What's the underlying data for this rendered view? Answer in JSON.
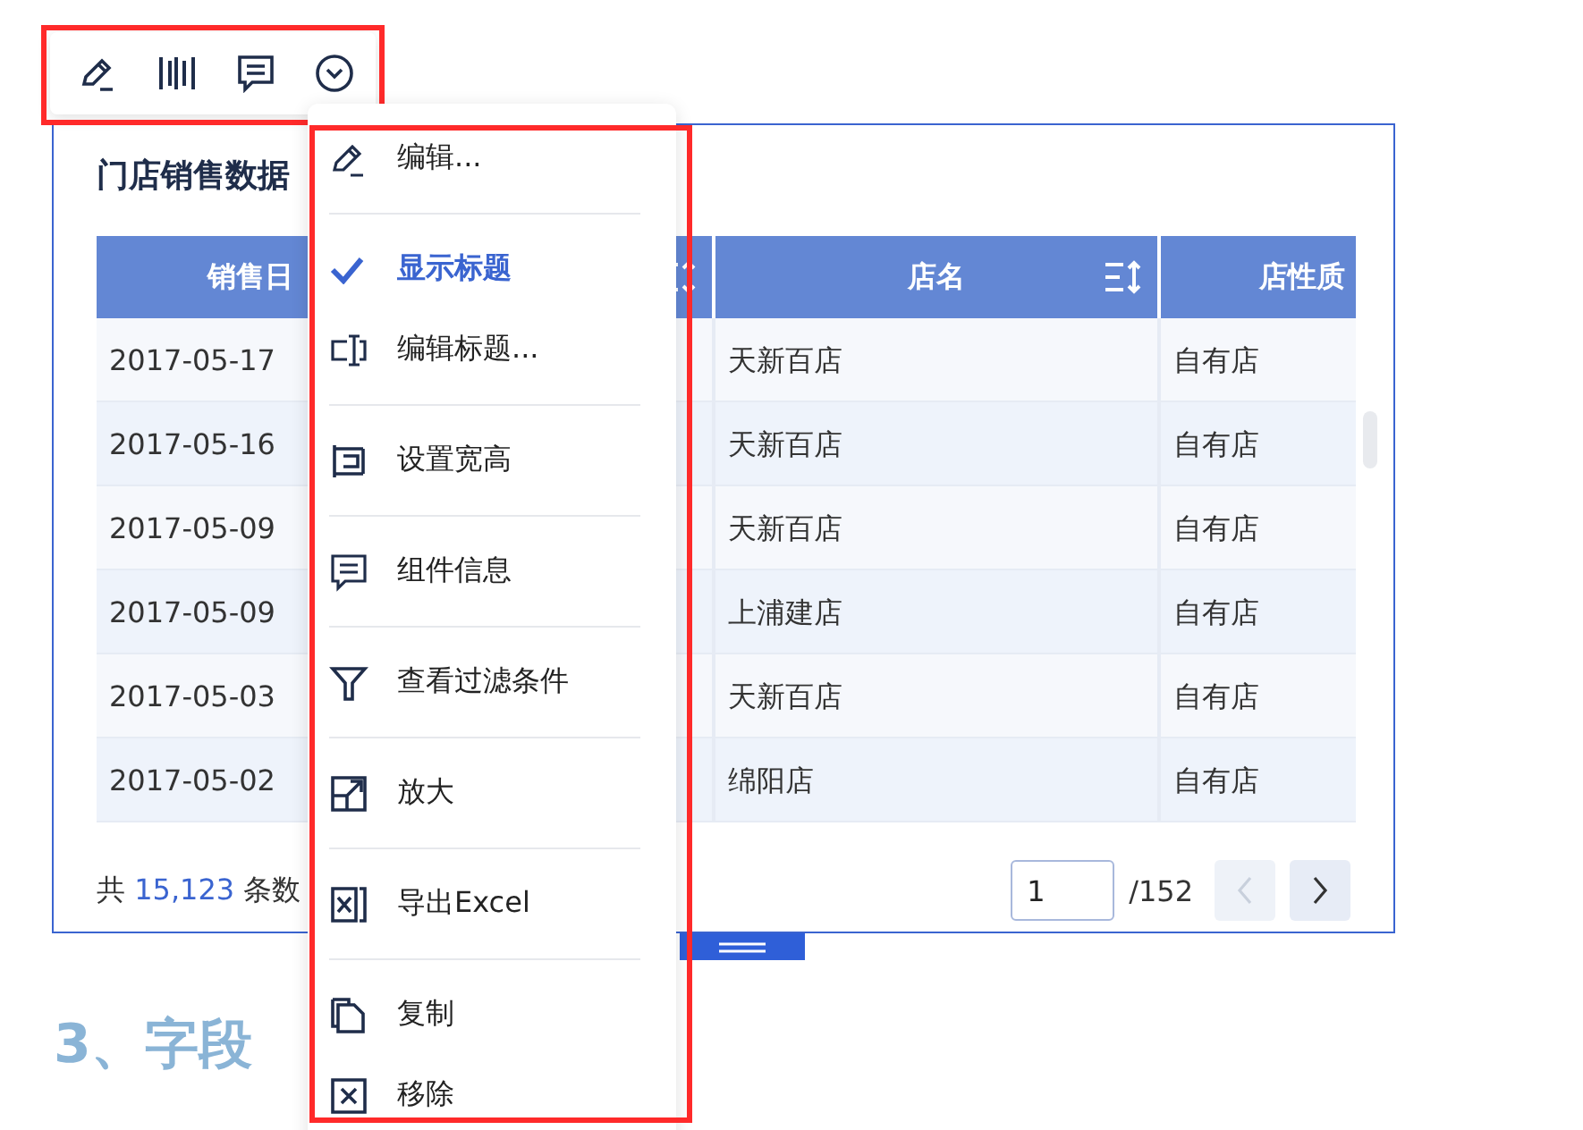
{
  "widget": {
    "title": "门店销售数据",
    "table": {
      "columns": [
        {
          "label": "销售日"
        },
        {
          "sortable": true
        },
        {
          "label": "店名",
          "sortable": true
        },
        {
          "label": "店性质"
        }
      ],
      "rows": [
        [
          "2017-05-17",
          "天新百店",
          "自有店"
        ],
        [
          "2017-05-16",
          "天新百店",
          "自有店"
        ],
        [
          "2017-05-09",
          "天新百店",
          "自有店"
        ],
        [
          "2017-05-09",
          "上浦建店",
          "自有店"
        ],
        [
          "2017-05-03",
          "天新百店",
          "自有店"
        ],
        [
          "2017-05-02",
          "绵阳店",
          "自有店"
        ]
      ]
    },
    "footer": {
      "prefix": "共",
      "total": "15,123",
      "suffix": "条数"
    },
    "pager": {
      "page": "1",
      "pages": "/152",
      "prev_disabled": true,
      "next_disabled": false
    }
  },
  "menu": {
    "groups": [
      [
        {
          "label": "编辑...",
          "kind": "action"
        }
      ],
      [
        {
          "label": "显示标题",
          "kind": "toggle",
          "checked": true
        },
        {
          "label": "编辑标题...",
          "kind": "action"
        }
      ],
      [
        {
          "label": "设置宽高",
          "kind": "action"
        }
      ],
      [
        {
          "label": "组件信息",
          "kind": "action"
        }
      ],
      [
        {
          "label": "查看过滤条件",
          "kind": "action"
        }
      ],
      [
        {
          "label": "放大",
          "kind": "action"
        }
      ],
      [
        {
          "label": "导出Excel",
          "kind": "action"
        }
      ],
      [
        {
          "label": "复制",
          "kind": "action"
        },
        {
          "label": "移除",
          "kind": "action"
        }
      ]
    ]
  },
  "section_heading": "3、字段"
}
